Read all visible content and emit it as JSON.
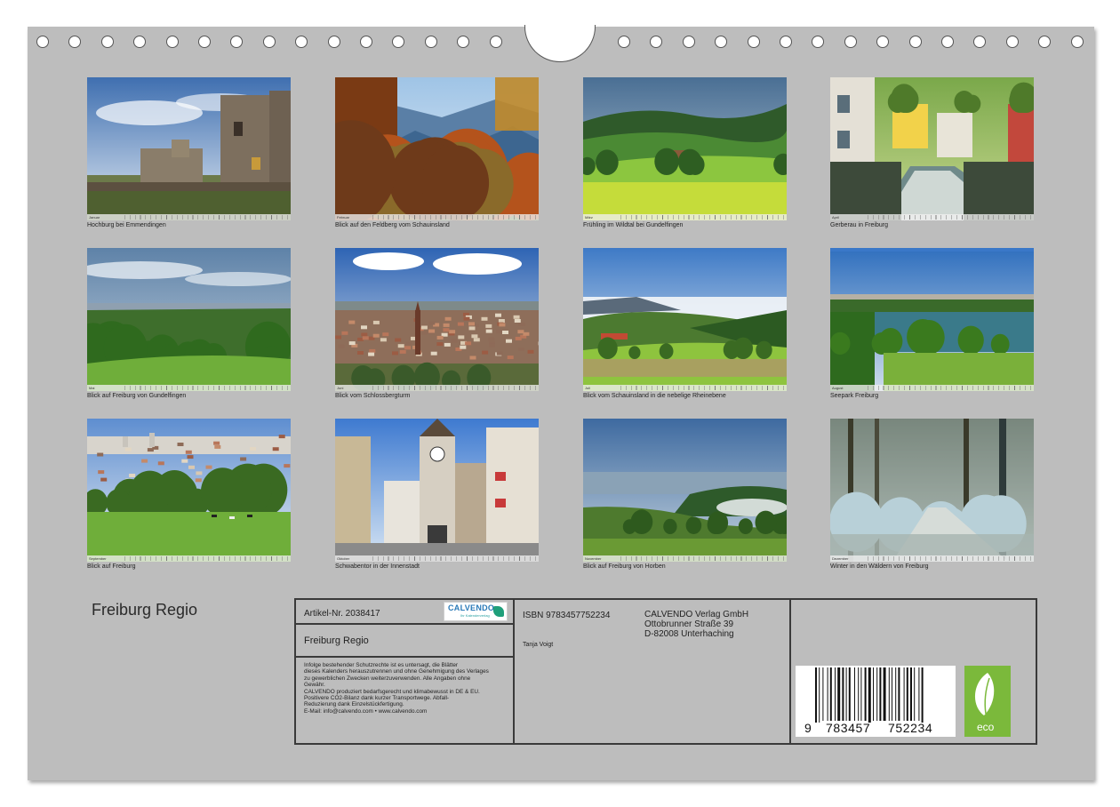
{
  "calendar": {
    "title": "Freiburg Regio",
    "months": [
      {
        "month": "Januar",
        "caption": "Hochburg bei Emmendingen",
        "scene": "castle-ruin-icon"
      },
      {
        "month": "Februar",
        "caption": "Blick auf den Feldberg vom Schauinsland",
        "scene": "autumn-valley-icon"
      },
      {
        "month": "März",
        "caption": "Frühling im Wildtal bei Gundelfingen",
        "scene": "spring-meadow-icon"
      },
      {
        "month": "April",
        "caption": "Gerberau in Freiburg",
        "scene": "canal-street-icon"
      },
      {
        "month": "Mai",
        "caption": "Blick auf Freiburg von Gundelfingen",
        "scene": "green-hills-icon"
      },
      {
        "month": "Juni",
        "caption": "Blick vom Schlossbergturm",
        "scene": "city-panorama-icon"
      },
      {
        "month": "Juli",
        "caption": "Blick vom Schauinsland in die nebelige Rheinebene",
        "scene": "foggy-plain-icon"
      },
      {
        "month": "August",
        "caption": "Seepark Freiburg",
        "scene": "lake-park-icon"
      },
      {
        "month": "September",
        "caption": "Blick auf Freiburg",
        "scene": "pasture-city-icon"
      },
      {
        "month": "Oktober",
        "caption": "Schwabentor in der Innenstadt",
        "scene": "city-gate-icon"
      },
      {
        "month": "November",
        "caption": "Blick auf Freiburg von Horben",
        "scene": "misty-hills-icon"
      },
      {
        "month": "Dezember",
        "caption": "Winter in den Wäldern von Freiburg",
        "scene": "frosty-forest-icon"
      }
    ]
  },
  "imprint": {
    "article_no": "Artikel-Nr. 2038417",
    "logo_text": "CALVENDO",
    "logo_sub": "Ihr Kalenderverlag",
    "product_title": "Freiburg Regio",
    "legal_lines": [
      "Infolge bestehender Schutzrechte ist es untersagt, die Blätter",
      "dieses Kalenders herauszutrennen und ohne Genehmigung des Verlages",
      "zu gewerblichen Zwecken weiterzuverwenden. Alle Angaben ohne",
      "Gewähr.",
      "CALVENDO produziert bedarfsgerecht und klimabewusst in DE & EU.",
      "Positivere CO2-Bilanz dank kurzer Transportwege. Abfall-",
      "Reduzierung dank Einzelstückfertigung.",
      "E-Mail: info@calvendo.com • www.calvendo.com"
    ],
    "isbn": "ISBN 9783457752234",
    "author": "Tanja Voigt",
    "publisher_lines": [
      "CALVENDO Verlag GmbH",
      "Ottobrunner Straße 39",
      "D-82008 Unterhaching"
    ],
    "barcode_digits": [
      "9",
      "783457",
      "752234"
    ],
    "eco_label": "eco"
  }
}
